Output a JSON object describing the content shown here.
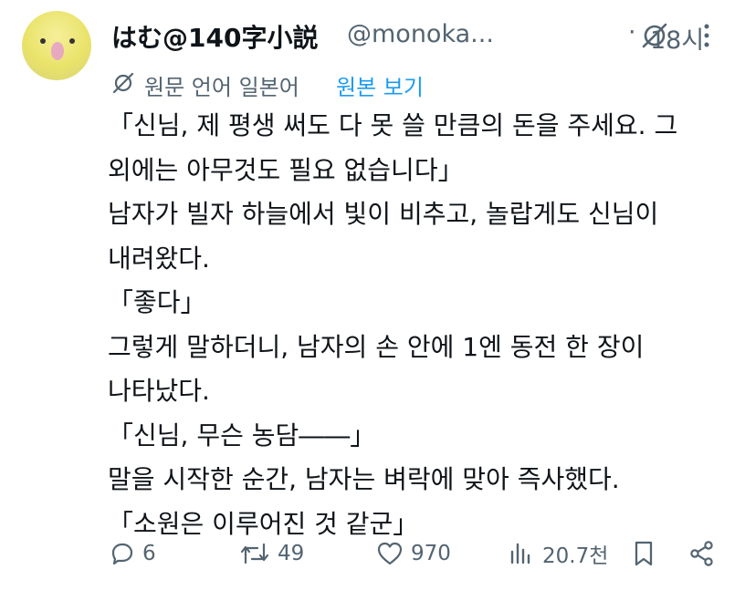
{
  "author": {
    "display_name": "はむ@140字小説",
    "handle": "@monoka...",
    "separator": "·",
    "time": "18시"
  },
  "translation": {
    "label": "원문 언어 일본어",
    "show_original": "원본 보기"
  },
  "body_lines": [
    "「신님, 제 평생 써도 다 못 쓸 만큼의 돈을 주세요. 그",
    "외에는 아무것도 필요 없습니다」",
    "남자가 빌자 하늘에서 빛이 비추고, 놀랍게도 신님이",
    "내려왔다.",
    "「좋다」",
    "그렇게 말하더니, 남자의 손 안에 1엔 동전 한 장이",
    "나타났다.",
    "「신님, 무슨 농담――」",
    "말을 시작한 순간, 남자는 벼락에 맞아 즉사했다.",
    "「소원은 이루어진 것 같군」"
  ],
  "actions": {
    "replies": "6",
    "reposts": "49",
    "likes": "970",
    "views": "20.7천"
  },
  "colors": {
    "text": "#0f1419",
    "muted": "#536471",
    "link": "#1d9bf0"
  }
}
